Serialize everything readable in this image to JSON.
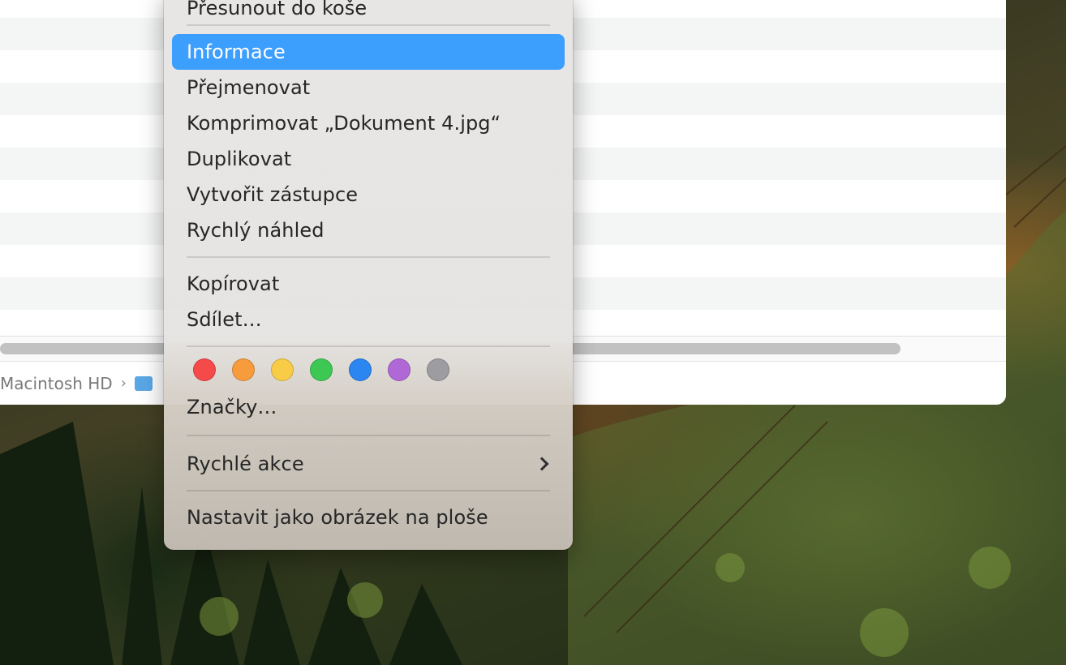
{
  "finder": {
    "path": [
      "Macintosh HD"
    ]
  },
  "context_menu": {
    "items": {
      "trash": "Přesunout do koše",
      "info": "Informace",
      "rename": "Přejmenovat",
      "compress": "Komprimovat „Dokument 4.jpg“",
      "duplicate": "Duplikovat",
      "alias": "Vytvořit zástupce",
      "quicklook": "Rychlý náhled",
      "copy": "Kopírovat",
      "share": "Sdílet…",
      "tags": "Značky…",
      "quick_actions": "Rychlé akce",
      "set_wallpaper": "Nastavit jako obrázek na ploše"
    },
    "selected": "Informace",
    "tag_colors": [
      {
        "name": "red",
        "hex": "#f6494a"
      },
      {
        "name": "orange",
        "hex": "#f79c3d"
      },
      {
        "name": "yellow",
        "hex": "#f9cc47"
      },
      {
        "name": "green",
        "hex": "#3dc853"
      },
      {
        "name": "blue",
        "hex": "#2b86f1"
      },
      {
        "name": "purple",
        "hex": "#b068d6"
      },
      {
        "name": "gray",
        "hex": "#9d9ca0"
      }
    ],
    "highlight_color": "#3c9efd"
  }
}
